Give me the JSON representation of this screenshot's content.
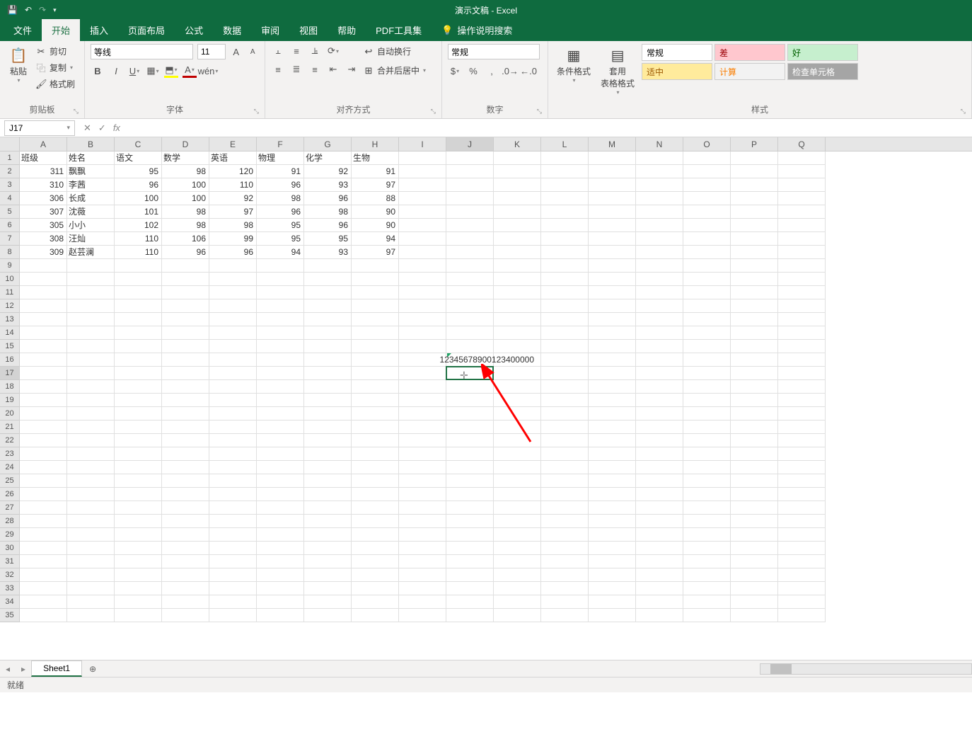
{
  "title": "演示文稿  -  Excel",
  "tabs": {
    "file": "文件",
    "home": "开始",
    "insert": "插入",
    "layout": "页面布局",
    "formulas": "公式",
    "data": "数据",
    "review": "审阅",
    "view": "视图",
    "help": "帮助",
    "pdf": "PDF工具集",
    "tellme": "操作说明搜索"
  },
  "clipboard": {
    "paste": "粘贴",
    "cut": "剪切",
    "copy": "复制",
    "painter": "格式刷",
    "label": "剪贴板"
  },
  "font": {
    "name": "等线",
    "size": "11",
    "label": "字体"
  },
  "align": {
    "wrap": "自动换行",
    "merge": "合并后居中",
    "label": "对齐方式"
  },
  "number": {
    "format": "常规",
    "label": "数字"
  },
  "styles": {
    "cond": "条件格式",
    "table": "套用\n表格格式",
    "label": "样式",
    "normal": "常规",
    "bad": "差",
    "good": "好",
    "neutral": "适中",
    "calc": "计算",
    "check": "检查单元格"
  },
  "namebox": "J17",
  "columns": [
    "A",
    "B",
    "C",
    "D",
    "E",
    "F",
    "G",
    "H",
    "I",
    "J",
    "K",
    "L",
    "M",
    "N",
    "O",
    "P",
    "Q"
  ],
  "headers": [
    "班级",
    "姓名",
    "语文",
    "数学",
    "英语",
    "物理",
    "化学",
    "生物"
  ],
  "data_rows": [
    [
      "311",
      "飘飘",
      "95",
      "98",
      "120",
      "91",
      "92",
      "91"
    ],
    [
      "310",
      "李茜",
      "96",
      "100",
      "110",
      "96",
      "93",
      "97"
    ],
    [
      "306",
      "长成",
      "100",
      "100",
      "92",
      "98",
      "96",
      "88"
    ],
    [
      "307",
      "沈薇",
      "101",
      "98",
      "97",
      "96",
      "98",
      "90"
    ],
    [
      "305",
      "小小",
      "102",
      "98",
      "98",
      "95",
      "96",
      "90"
    ],
    [
      "308",
      "汪灿",
      "110",
      "106",
      "99",
      "95",
      "95",
      "94"
    ],
    [
      "309",
      "赵芸澜",
      "110",
      "96",
      "96",
      "94",
      "93",
      "97"
    ]
  ],
  "overflow_value": "12345678900123400000",
  "sheet": "Sheet1",
  "status": "就绪"
}
